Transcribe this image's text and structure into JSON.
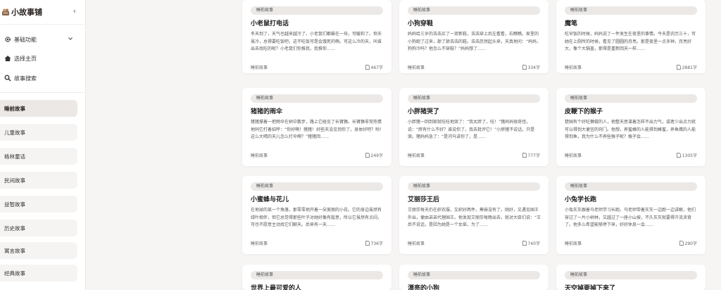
{
  "brand": {
    "title": "小故事铺",
    "collapse_glyph": "‹"
  },
  "menu": {
    "basic": {
      "label": "基础功能"
    },
    "select_home": {
      "label": "选择主页"
    },
    "search": {
      "label": "故事搜索"
    }
  },
  "categories": [
    {
      "label": "睡前故事",
      "active": true
    },
    {
      "label": "儿童故事",
      "active": false
    },
    {
      "label": "格林童话",
      "active": false
    },
    {
      "label": "民间故事",
      "active": false
    },
    {
      "label": "益智故事",
      "active": false
    },
    {
      "label": "历史故事",
      "active": false
    },
    {
      "label": "寓言故事",
      "active": false
    },
    {
      "label": "经典故事",
      "active": false
    }
  ],
  "cards": [
    {
      "tag": "睡前故事",
      "title": "小老鼠打电话",
      "excerpt": "冬天到了，天气也越来越冷了，小老鼠们都躲在一块，可暖和了。但天虽冷，总得要吃饭吧，这不吃饭可是会饿死的啊。可这么冷的天，叫谁出去找吃的呢？小老鼠们你推我，我推你……",
      "category": "睡前故事",
      "words": "467字"
    },
    {
      "tag": "睡前故事",
      "title": "小狗穿鞋",
      "excerpt": "妈妈给三岁的浩浩买了一双新鞋，浩浩穿上后左看看，右瞧瞧。家里的小狗跑了过来，舔了舔浩浩的鞋。浩浩忽然起头来，天真地问：“妈妈，狗狗冷吗？他怎么不穿鞋？”妈妈想了……",
      "category": "睡前故事",
      "words": "334字"
    },
    {
      "tag": "睡前故事",
      "title": "魔笔",
      "excerpt": "吃罕饭的时候，妈妈说了一件发生在夜里的事情。今天是农历三十，可她在上厕所的时候，看见了圆圆的月亮。那是夜里一点多钟，月亮好大，像个大锅盖，那得是重新回天一样……",
      "category": "睡前故事",
      "words": "2881字"
    },
    {
      "tag": "睡前故事",
      "title": "猪猪的雨伞",
      "excerpt": "猪猪撑着一把雨伞在树中散步，路上它碰见了长臂猿。长臂猿非常热情地同它打着招呼：“你好啊！猪猪！好些天没见到你了，身体好吧？哟！这么大晴的天儿怎么打伞啊？”猪猪回……",
      "category": "睡前故事",
      "words": "249字"
    },
    {
      "tag": "睡前故事",
      "title": "小胖猪哭了",
      "excerpt": "小胖猪一回到家就哇哇地哭了：“我太胖了，哇！”猪妈妈很奇怪，说：“胖有什么不好？谁说你了，我去批评它！”小胖猪不说话，只是哭。猪妈妈急了：“是河马讲你了，是……",
      "category": "睡前故事",
      "words": "777字"
    },
    {
      "tag": "睡前故事",
      "title": "皮鞭下的猴子",
      "excerpt": "楚国有个好吃懒做的人，他整天思谋着怎样不出力气，或者少出点力就可以得到大便宜的窍门。他想，养蜜蜂的人能得到蜂蜜，养鱼鹰的人能得到鱼，我为什么不养些猴子呢？猴子会……",
      "category": "睡前故事",
      "words": "1305字"
    },
    {
      "tag": "睡前故事",
      "title": "小蜜蜂与花儿",
      "excerpt": "在地球的某一个角落，那零零地开着一朵美丽的小花。它的身边虽然有绿叶相伴，但它总觉得那些叶子对她好像有敌意，所以它虽然有点闷，可也不愿意主动找它们聊天。后来有一天……",
      "category": "睡前故事",
      "words": "736字"
    },
    {
      "tag": "睡前故事",
      "title": "艾丽莎王后",
      "excerpt": "艾丽莎每天仍在织衣服，又织好两件，筹麻没有了。刚好，又遇见国王外出，便由弟弟代理国王。他发现艾丽莎每晚出去，就对大臣们说：“王后不说话，是因为她是一个女巫，为了……",
      "category": "睡前故事",
      "words": "740字"
    },
    {
      "tag": "睡前故事",
      "title": "小兔学长跑",
      "excerpt": "小兔灰灰跟着马老师学习长跑。马老师带着灰灰一边跑一边讲解，他们穿过了一片小树林，又越过了一座小山坡，不久灰灰就要得汗流浃背了。他多么希望能够停下来，好好休息一会……",
      "category": "睡前故事",
      "words": "290字"
    },
    {
      "tag": "睡前故事",
      "title": "世界上最可爱的人",
      "excerpt": "",
      "category": "睡前故事",
      "words": ""
    },
    {
      "tag": "睡前故事",
      "title": "漂亮的小狗",
      "excerpt": "",
      "category": "睡前故事",
      "words": ""
    },
    {
      "tag": "睡前故事",
      "title": "天空掉要掉下来了",
      "excerpt": "",
      "category": "睡前故事",
      "words": ""
    }
  ],
  "colors": {
    "accent": "#2b2320",
    "active_bg": "#ece8e5",
    "page_bg": "#f6f5f4"
  },
  "icons": {
    "logo": "brand-logo-icon",
    "gear": "gear-icon",
    "home": "home-icon",
    "search": "search-icon",
    "chevron": "chevron-down-icon",
    "doc": "document-icon"
  }
}
